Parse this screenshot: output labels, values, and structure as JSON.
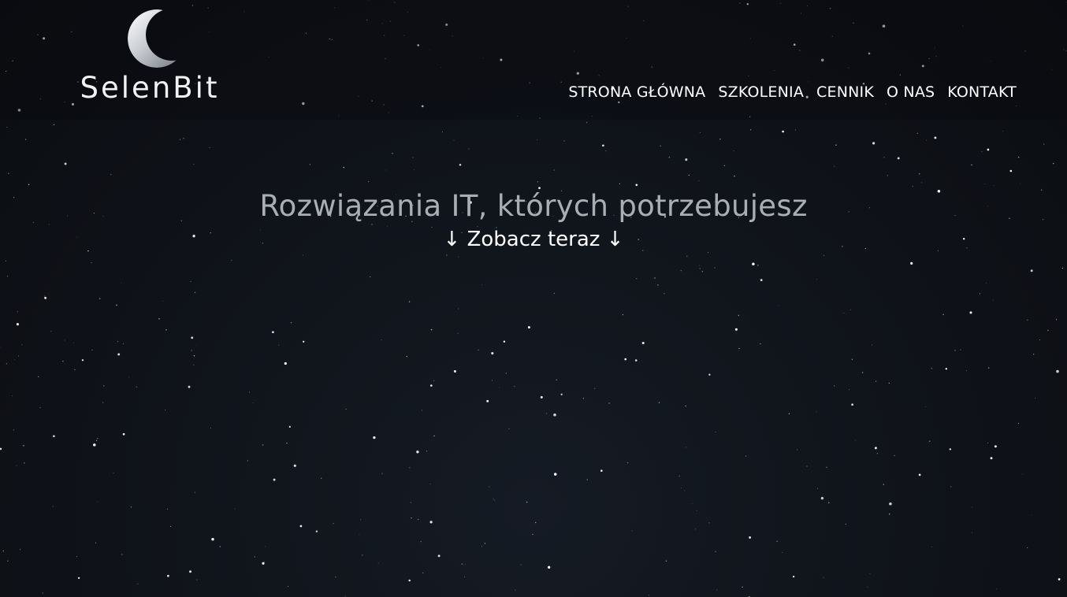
{
  "brand": {
    "name": "SelenBit"
  },
  "nav": {
    "items": [
      {
        "label": "STRONA GŁÓWNA"
      },
      {
        "label": "SZKOLENIA"
      },
      {
        "label": "CENNIK"
      },
      {
        "label": "O NAS"
      },
      {
        "label": "KONTAKT"
      }
    ]
  },
  "hero": {
    "title": "Rozwiązania IT, których potrzebujesz",
    "cta_label": "↓ Zobacz teraz ↓"
  },
  "colors": {
    "background": "#0b0d11",
    "title_text": "#a9aeb5",
    "nav_text": "#ffffff",
    "star": "#ffffff"
  },
  "icons": {
    "logo": "crescent-moon-icon",
    "background": "starfield"
  }
}
